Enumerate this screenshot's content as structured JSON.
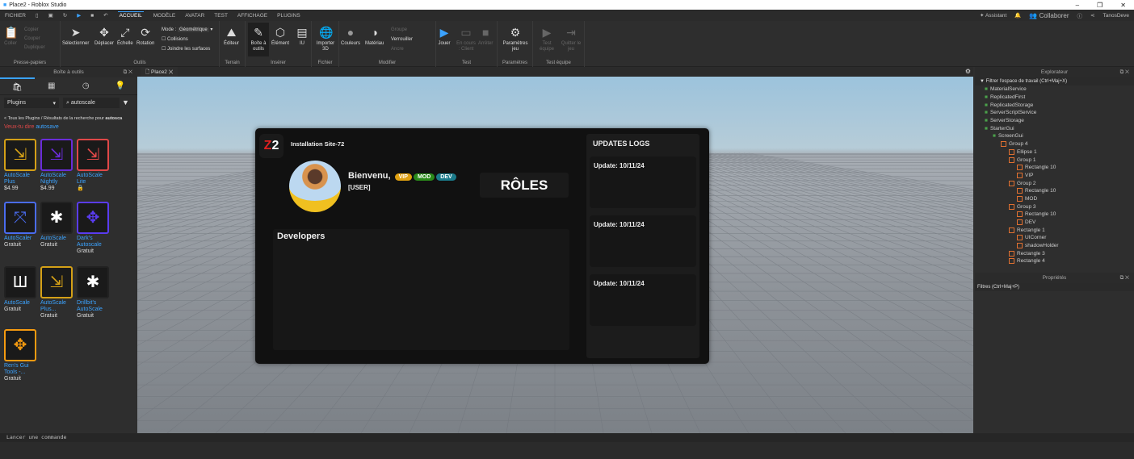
{
  "window": {
    "title": "Place2 - Roblox Studio",
    "minimize": "–",
    "restore": "❐",
    "close": "✕"
  },
  "menu": {
    "file": "FICHIER",
    "tabs": [
      "ACCUEIL",
      "MODÈLE",
      "AVATAR",
      "TEST",
      "AFFICHAGE",
      "PLUGINS"
    ],
    "assistant": "Assistant",
    "collab": "Collaborer",
    "user": "TanosDeve"
  },
  "ribbon": {
    "clipboard": {
      "paste": "Coller",
      "copy": "Copier",
      "cut": "Couper",
      "duplicate": "Dupliquer",
      "label": "Presse-papiers"
    },
    "tools": {
      "select": "Sélectionner",
      "move": "Déplacer",
      "scale": "Échelle",
      "rotate": "Rotation",
      "mode_label": "Mode :",
      "mode_value": "Géométrique",
      "collisions": "Collisions",
      "join": "Joindre les surfaces",
      "label": "Outils"
    },
    "terrain": {
      "editor": "Éditeur",
      "label": "Terrain"
    },
    "insert": {
      "toolbox": "Boîte à outils",
      "element": "Élément",
      "ui": "IU",
      "label": "Insérer"
    },
    "file": {
      "import": "Importer 3D",
      "label": "Fichier"
    },
    "modify": {
      "colors": "Couleurs",
      "material": "Matériau",
      "group": "Groupe",
      "lock": "Verrouiller",
      "anchor": "Ancre",
      "label": "Modifier"
    },
    "test": {
      "play": "Jouer",
      "current_client": "En cours : Client",
      "stop": "Arrêter",
      "label": "Test"
    },
    "settings": {
      "game": "Paramètres jeu",
      "label": "Paramètres"
    },
    "team": {
      "test": "Test équipe",
      "leave": "Quitter le jeu",
      "label": "Test équipe"
    }
  },
  "toolbox": {
    "title": "Boîte à outils",
    "category": "Plugins",
    "search": "autoscale",
    "breadcrumb": "< Tous les Plugins / Résultats de la recherche pour ",
    "breadcrumb_term": "autosca",
    "suggest": "Veux-tu dire ",
    "suggest_term": "autosave",
    "items": [
      {
        "name": "AutoScale Plus",
        "price": "$4.99",
        "color": "#d4a017"
      },
      {
        "name": "AutoScale Nightly",
        "price": "$4.99",
        "color": "#6a2cd8"
      },
      {
        "name": "AutoScale Lite",
        "price": "🔒",
        "color": "#e04848"
      },
      {
        "name": "AutoScaler",
        "price": "Gratuit",
        "color": "#4a6cf0"
      },
      {
        "name": "AutoScale",
        "price": "Gratuit",
        "color": "#222"
      },
      {
        "name": "Dark's Autoscale",
        "price": "Gratuit",
        "color": "#5a3cf0"
      },
      {
        "name": "AutoScale",
        "price": "Gratuit",
        "color": "#222"
      },
      {
        "name": "AutoScale Plus...",
        "price": "Gratuit",
        "color": "#d4a017"
      },
      {
        "name": "Drillbit's AutoScale",
        "price": "Gratuit",
        "color": "#222"
      },
      {
        "name": "Ren's Gui Tools -...",
        "price": "Gratuit",
        "color": "#f59a10"
      }
    ]
  },
  "doc_tab": "Place2",
  "gui": {
    "site": "Installation Site-72",
    "welcome": "Bienvenu,",
    "user": "[USER]",
    "badges": [
      {
        "t": "VIP",
        "c": "#e0a010"
      },
      {
        "t": "MOD",
        "c": "#2a8a1a"
      },
      {
        "t": "DEV",
        "c": "#1a7a8a"
      }
    ],
    "roles": "RÔLES",
    "developers": "Developers",
    "updates_title": "UPDATES LOGS",
    "updates": [
      "Update: 10/11/24",
      "Update: 10/11/24",
      "Update: 10/11/24"
    ]
  },
  "explorer": {
    "title": "Explorateur",
    "filter": "Filtrer l'espace de travail (Ctrl+Maj+X)",
    "tree": [
      {
        "n": "MaterialService",
        "d": 0
      },
      {
        "n": "ReplicatedFirst",
        "d": 0
      },
      {
        "n": "ReplicatedStorage",
        "d": 0
      },
      {
        "n": "ServerScriptService",
        "d": 0
      },
      {
        "n": "ServerStorage",
        "d": 0
      },
      {
        "n": "StarterGui",
        "d": 0
      },
      {
        "n": "ScreenGui",
        "d": 1
      },
      {
        "n": "Group 4",
        "d": 2
      },
      {
        "n": "Ellipse 1",
        "d": 3
      },
      {
        "n": "Group 1",
        "d": 3
      },
      {
        "n": "Rectangle 10",
        "d": 4
      },
      {
        "n": "VIP",
        "d": 4
      },
      {
        "n": "Group 2",
        "d": 3
      },
      {
        "n": "Rectangle 10",
        "d": 4
      },
      {
        "n": "MOD",
        "d": 4
      },
      {
        "n": "Group 3",
        "d": 3
      },
      {
        "n": "Rectangle 10",
        "d": 4
      },
      {
        "n": "DEV",
        "d": 4
      },
      {
        "n": "Rectangle 1",
        "d": 3
      },
      {
        "n": "UICorner",
        "d": 4
      },
      {
        "n": "shadowHolder",
        "d": 4
      },
      {
        "n": "Rectangle 3",
        "d": 3
      },
      {
        "n": "Rectangle 4",
        "d": 3
      }
    ]
  },
  "properties": {
    "title": "Propriétés",
    "filter": "Filtres (Ctrl+Maj+P)"
  },
  "command": {
    "placeholder": "Lancer une commande"
  }
}
